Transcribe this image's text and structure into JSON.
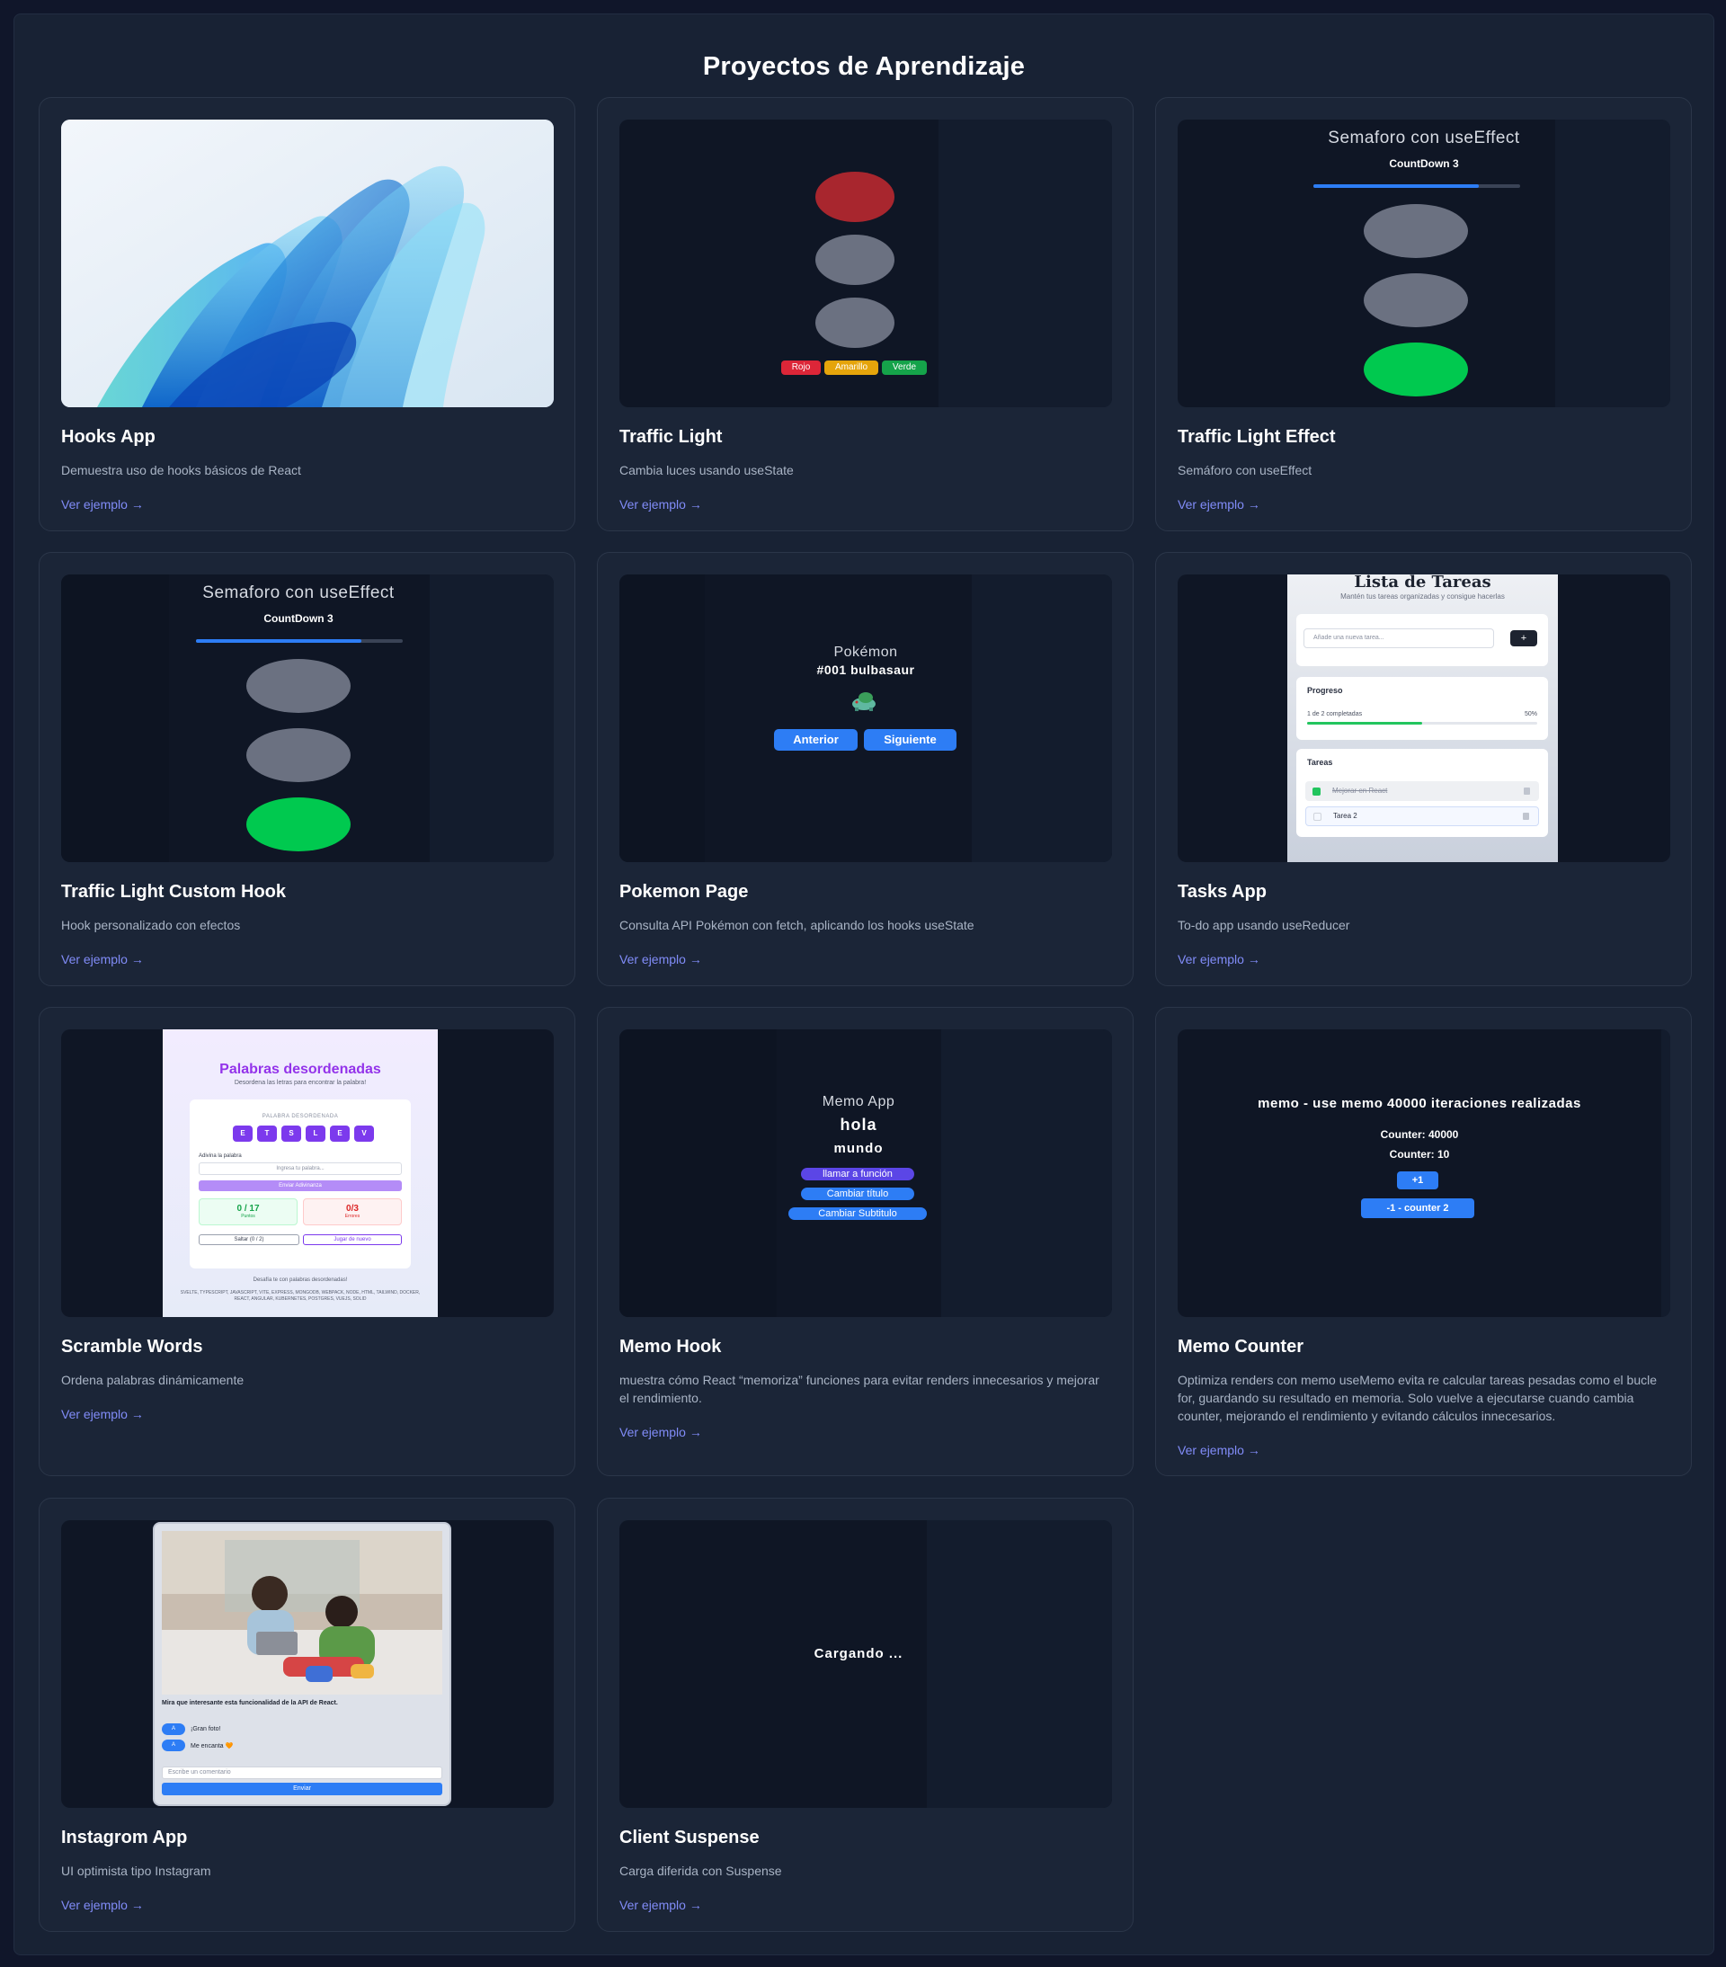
{
  "page": {
    "title": "Proyectos de Aprendizaje"
  },
  "link_label": "Ver ejemplo →",
  "cards": [
    {
      "title": "Hooks App",
      "desc": "Demuestra uso de hooks básicos de React"
    },
    {
      "title": "Traffic Light",
      "desc": "Cambia luces usando useState",
      "preview": {
        "buttons": [
          "Rojo",
          "Amarillo",
          "Verde"
        ]
      }
    },
    {
      "title": "Traffic Light Effect",
      "desc": "Semáforo con useEffect",
      "preview": {
        "heading": "Semaforo con useEffect",
        "countdown": "CountDown 3",
        "progress": 0.8
      }
    },
    {
      "title": "Traffic Light Custom Hook",
      "desc": "Hook personalizado con efectos",
      "preview": {
        "heading": "Semaforo con useEffect",
        "countdown": "CountDown 3",
        "progress": 0.8
      }
    },
    {
      "title": "Pokemon Page",
      "desc": "Consulta API Pokémon con fetch, aplicando los hooks useState",
      "preview": {
        "heading": "Pokémon",
        "name": "#001 bulbasaur",
        "prev": "Anterior",
        "next": "Siguiente"
      }
    },
    {
      "title": "Tasks App",
      "desc": "To-do app usando useReducer",
      "preview": {
        "heading": "Lista de Tareas",
        "subheading": "Mantén tus tareas organizadas y consigue hacerlas",
        "input_placeholder": "Añade una nueva tarea...",
        "add": "+",
        "progress_label": "Progreso",
        "progress_text": "1 de 2 completadas",
        "progress_pct": "50%",
        "tasks_label": "Tareas",
        "tasks": [
          "Mejorar en React",
          "Tarea 2"
        ]
      }
    },
    {
      "title": "Scramble Words",
      "desc": "Ordena palabras dinámicamente",
      "preview": {
        "heading": "Palabras desordenadas",
        "subheading": "Desordena las letras para encontrar la palabra!",
        "scrambled_label": "PALABRA DESORDENADA",
        "letters": [
          "E",
          "T",
          "S",
          "L",
          "E",
          "V"
        ],
        "guess_label": "Adivina la palabra",
        "guess_placeholder": "Ingresa tu palabra...",
        "submit": "Enviar Adivinanza",
        "points": "0 / 17",
        "points_label": "Puntos",
        "errors": "0/3",
        "errors_label": "Errores",
        "skip": "Saltar (0 / 2)",
        "reset": "Jugar de nuevo",
        "footer": "Desafía te con palabras desordenadas!",
        "words": "SVELTE, TYPESCRIPT, JAVASCRIPT, VITE, EXPRESS, MONGODB, WEBPACK, NODE, HTML, TAILWIND, DOCKER, REACT, ANGULAR, KUBERNETES, POSTGRES, VUEJS, SOLID"
      }
    },
    {
      "title": "Memo Hook",
      "desc": "muestra cómo React “memoriza” funciones para evitar renders innecesarios y mejorar el rendimiento.",
      "preview": {
        "heading": "Memo App",
        "line1": "hola",
        "line2": "mundo",
        "b1": "llamar a función",
        "b2": "Cambiar título",
        "b3": "Cambiar Subtitulo"
      }
    },
    {
      "title": "Memo Counter",
      "desc": "Optimiza renders con memo useMemo evita re calcular tareas pesadas como el bucle for, guardando su resultado en memoria. Solo vuelve a ejecutarse cuando cambia counter, mejorando el rendimiento y evitando cálculos innecesarios.",
      "preview": {
        "heading": "memo - use memo 40000 iteraciones realizadas",
        "c1": "Counter: 40000",
        "c2": "Counter: 10",
        "b1": "+1",
        "b2": "-1 - counter 2"
      }
    },
    {
      "title": "Instagrom App",
      "desc": "UI optimista tipo Instagram",
      "preview": {
        "caption": "Mira que interesante esta funcionalidad de la API de React.",
        "comments": [
          {
            "avatar": "A",
            "text": "¡Gran foto!"
          },
          {
            "avatar": "A",
            "text": "Me encanta 🧡"
          }
        ],
        "input_placeholder": "Escribe un comentario",
        "send": "Enviar"
      }
    },
    {
      "title": "Client Suspense",
      "desc": "Carga diferida con Suspense",
      "preview": {
        "loading": "Cargando ..."
      }
    }
  ],
  "colors": {
    "red": "#a8262e",
    "green": "#00c94f",
    "gray": "#6b7181",
    "accent": "#818cf8",
    "blue": "#2d7df5"
  }
}
